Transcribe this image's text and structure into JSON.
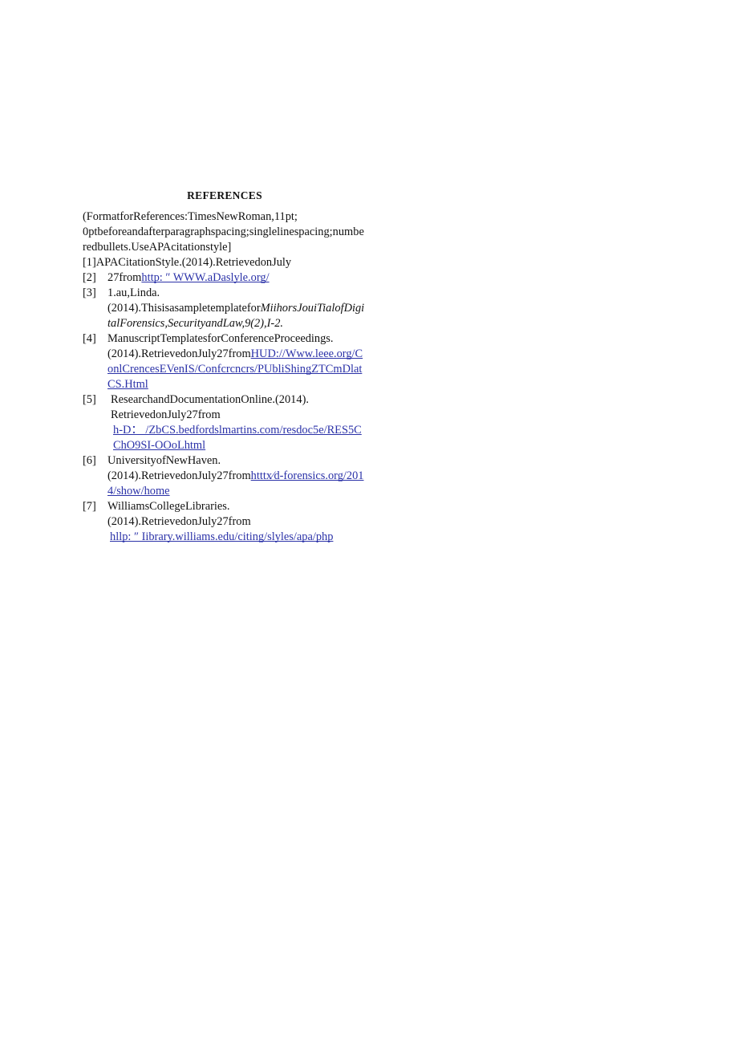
{
  "document": {
    "heading": "REFERENCES",
    "format_note": "(FormatforReferences:TimesNewRoman,11pt; 0ptbeforeandafterparagraphspacing;singlelinespacing;numberedbullets.UseAPAcitationstyle]",
    "link_color": "#2b32a8",
    "text_color": "#111111",
    "background_color": "#ffffff"
  },
  "references": [
    {
      "marker": "[1]",
      "text": "APACitationStyle.(2014).RetrievedonJuly",
      "link": null
    },
    {
      "marker": "[2]",
      "text": "27from",
      "link": "http: ″ WWW.aDaslyle.org/"
    },
    {
      "marker": "[3]",
      "text": "1.au,Linda.(2014).Thisisasampletemplatefor",
      "italic": "MiihorsJouiTialofDigitalForensics,SecurityandLaw,9(2),I-2.",
      "link": null
    },
    {
      "marker": "[4]",
      "text": "ManuscriptTemplatesforConferenceProceedings.(2014).RetrievedonJuly27from",
      "link": "HUD://Www.leee.org/ConlCrencesEVenIS/Confcrcncrs/PUbliShingZTCmDlatCS.Html"
    },
    {
      "marker": "[5]",
      "text": "ResearchandDocumentationOnline.(2014). RetrievedonJuly27from",
      "link": "h-D： /ZbCS.bedfordslmartins.com/resdoc5e/RES5CChO9SI-OOoLhtml",
      "link_on_own_line": true
    },
    {
      "marker": "[6]",
      "text": "UniversityofNewHaven.(2014).RetrievedonJuly27from",
      "link": "htttx⁄d-forensics.org/2014/show/home"
    },
    {
      "marker": "[7]",
      "text": "WilliamsCollegeLibraries.(2014).RetrievedonJuly27from",
      "link": "hllp: ″ Iibrary.williams.edu/citing/slyles/apa/php",
      "link_on_own_line": true
    }
  ]
}
